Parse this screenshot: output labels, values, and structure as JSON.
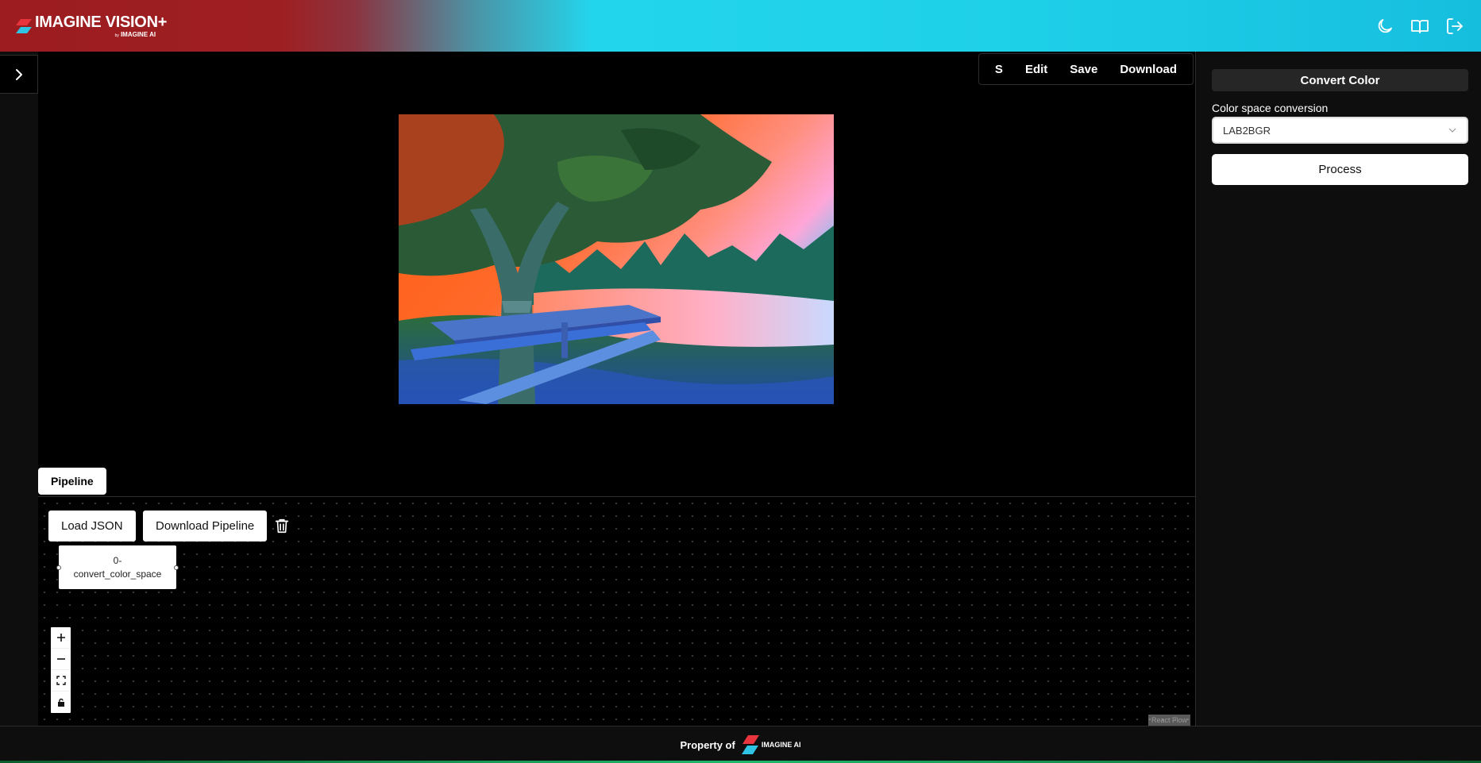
{
  "header": {
    "logo_title": "IMAGINE VISION+",
    "logo_by": "by",
    "logo_company": "IMAGINE AI",
    "actions": [
      {
        "icon": "moon-icon"
      },
      {
        "icon": "book-icon"
      },
      {
        "icon": "logout-icon"
      }
    ]
  },
  "sidebar": {
    "toggle_icon": "chevron-right-icon"
  },
  "toolbar": {
    "s_label": "S",
    "edit_label": "Edit",
    "save_label": "Save",
    "download_label": "Download"
  },
  "pipeline": {
    "tab_label": "Pipeline",
    "load_json_label": "Load JSON",
    "download_pipeline_label": "Download Pipeline",
    "node": {
      "line1": "0-",
      "line2": "convert_color_space"
    },
    "attribution": "React Flow"
  },
  "right_panel": {
    "title": "Convert Color",
    "field_label": "Color space conversion",
    "select_value": "LAB2BGR",
    "process_label": "Process"
  },
  "footer": {
    "label": "Property of",
    "logo_text": "IMAGINE AI"
  },
  "colors": {
    "header_left": "#9c1c20",
    "header_right": "#1ecfe8",
    "background": "#000000",
    "panel": "#0e0e0e"
  }
}
